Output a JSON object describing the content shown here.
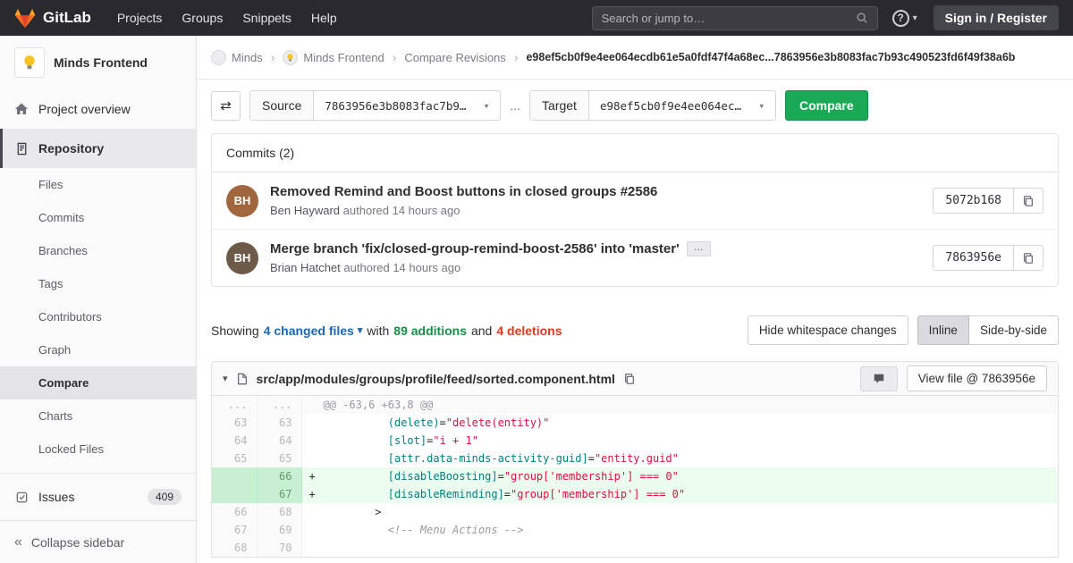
{
  "colors": {
    "accent_orange": "#fc6d26",
    "navbar_bg": "#29292e",
    "success_green": "#1aaa55",
    "link_blue": "#1b69b6",
    "addition_green": "#168f48",
    "deletion_red": "#db3b21",
    "added_line_bg": "#ecfdf0"
  },
  "icons": {
    "chevron_down": "▾",
    "swap": "⇄",
    "help": "?",
    "breadcrumb_sep": "›",
    "collapse": "«",
    "ellipsis": "…"
  },
  "navbar": {
    "brand": "GitLab",
    "menu": [
      "Projects",
      "Groups",
      "Snippets",
      "Help"
    ],
    "search": {
      "placeholder": "Search or jump to…"
    },
    "sign_in_label": "Sign in / Register"
  },
  "breadcrumb": {
    "crumbs": [
      "Minds",
      "Minds Frontend",
      "Compare Revisions"
    ],
    "current": "e98ef5cb0f9e4ee064ecdb61e5a0fdf47f4a68ec...7863956e3b8083fac7b93c490523fd6f49f38a6b"
  },
  "sidebar": {
    "project_name": "Minds Frontend",
    "overview_label": "Project overview",
    "repository_label": "Repository",
    "repository_items": [
      "Files",
      "Commits",
      "Branches",
      "Tags",
      "Contributors",
      "Graph",
      "Compare",
      "Charts",
      "Locked Files"
    ],
    "issues_label": "Issues",
    "issues_count": "409",
    "collapse_label": "Collapse sidebar"
  },
  "compare": {
    "source_label": "Source",
    "source_value": "7863956e3b8083fac7b9…",
    "dots": "...",
    "target_label": "Target",
    "target_value": "e98ef5cb0f9e4ee064ec…",
    "button_label": "Compare"
  },
  "commits": {
    "title": "Commits (2)",
    "more_label": "…",
    "list": [
      {
        "title": "Removed Remind and Boost buttons in closed groups #2586",
        "author": "Ben Hayward",
        "meta": "authored 14 hours ago",
        "sha": "5072b168",
        "initials": "BH"
      },
      {
        "title": "Merge branch 'fix/closed-group-remind-boost-2586' into 'master'",
        "author": "Brian Hatchet",
        "meta": "authored 14 hours ago",
        "sha": "7863956e",
        "initials": "BH"
      }
    ]
  },
  "summary": {
    "showing": "Showing",
    "files_link": "4 changed files",
    "with_text": "with",
    "additions": "89 additions",
    "and_text": "and",
    "deletions": "4 deletions",
    "whitespace_btn": "Hide whitespace changes",
    "inline_btn": "Inline",
    "side_btn": "Side-by-side"
  },
  "diff": {
    "path": "src/app/modules/groups/profile/feed/sorted.component.html",
    "view_file_label": "View file @ 7863956e",
    "rows": [
      {
        "old": "...",
        "new": "...",
        "kind": "hunk",
        "segs": [
          {
            "cls": "hunk",
            "t": "@@ -63,6 +63,8 @@"
          }
        ]
      },
      {
        "old": "63",
        "new": "63",
        "kind": "ctx",
        "segs": [
          {
            "cls": "plain",
            "t": "          "
          },
          {
            "cls": "attr",
            "t": "(delete)"
          },
          {
            "cls": "plain",
            "t": "="
          },
          {
            "cls": "str",
            "t": "\"delete(entity)\""
          }
        ]
      },
      {
        "old": "64",
        "new": "64",
        "kind": "ctx",
        "segs": [
          {
            "cls": "plain",
            "t": "          "
          },
          {
            "cls": "attr",
            "t": "[slot]"
          },
          {
            "cls": "plain",
            "t": "="
          },
          {
            "cls": "str",
            "t": "\"i + 1\""
          }
        ]
      },
      {
        "old": "65",
        "new": "65",
        "kind": "ctx",
        "segs": [
          {
            "cls": "plain",
            "t": "          "
          },
          {
            "cls": "attr",
            "t": "[attr.data-minds-activity-guid]"
          },
          {
            "cls": "plain",
            "t": "="
          },
          {
            "cls": "str",
            "t": "\"entity.guid\""
          }
        ]
      },
      {
        "old": "",
        "new": "66",
        "kind": "add",
        "segs": [
          {
            "cls": "plain",
            "t": "          "
          },
          {
            "cls": "attr",
            "t": "[disableBoosting]"
          },
          {
            "cls": "plain",
            "t": "="
          },
          {
            "cls": "str",
            "t": "\"group['membership'] === 0\""
          }
        ]
      },
      {
        "old": "",
        "new": "67",
        "kind": "add",
        "segs": [
          {
            "cls": "plain",
            "t": "          "
          },
          {
            "cls": "attr",
            "t": "[disableReminding]"
          },
          {
            "cls": "plain",
            "t": "="
          },
          {
            "cls": "str",
            "t": "\"group['membership'] === 0\""
          }
        ]
      },
      {
        "old": "66",
        "new": "68",
        "kind": "ctx",
        "segs": [
          {
            "cls": "plain",
            "t": "        >"
          }
        ]
      },
      {
        "old": "67",
        "new": "69",
        "kind": "ctx",
        "segs": [
          {
            "cls": "plain",
            "t": "          "
          },
          {
            "cls": "comment",
            "t": "<!-- Menu Actions -->"
          }
        ]
      },
      {
        "old": "68",
        "new": "70",
        "kind": "ctx",
        "segs": [
          {
            "cls": "plain",
            "t": ""
          }
        ]
      }
    ]
  }
}
